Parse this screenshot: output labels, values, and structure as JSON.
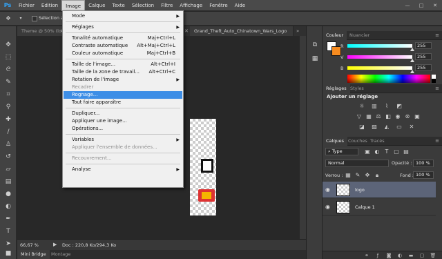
{
  "app": {
    "logo": "Ps"
  },
  "menubar": {
    "items": [
      "Fichier",
      "Edition",
      "Image",
      "Calque",
      "Texte",
      "Sélection",
      "Filtre",
      "Affichage",
      "Fenêtre",
      "Aide"
    ],
    "active": "Image"
  },
  "window_controls": {
    "minimize": "—",
    "maximize": "□",
    "close": "✕"
  },
  "options_bar": {
    "auto_select_label": "Sélection aut"
  },
  "documents": {
    "tabs": [
      {
        "title": "Theme @ 50% (log",
        "close": "✕"
      },
      {
        "title": "Grand_Theft_Auto_Chinatown_Wars_Logo",
        "close": "✕"
      }
    ],
    "overflow_indicator": "»"
  },
  "status_bar": {
    "zoom": "66,67 %",
    "doc_info": "Doc : 220,8 Ko/294,3 Ko",
    "arrow": "▶"
  },
  "bottom_tabs": [
    "Mini Bridge",
    "Montage"
  ],
  "image_menu": {
    "items": [
      {
        "label": "Mode",
        "shortcut": "",
        "submenu": true,
        "disabled": false
      },
      {
        "sep": true
      },
      {
        "label": "Réglages",
        "shortcut": "",
        "submenu": true,
        "disabled": false
      },
      {
        "sep": true
      },
      {
        "label": "Tonalité automatique",
        "shortcut": "Maj+Ctrl+L",
        "submenu": false,
        "disabled": false
      },
      {
        "label": "Contraste automatique",
        "shortcut": "Alt+Maj+Ctrl+L",
        "submenu": false,
        "disabled": false
      },
      {
        "label": "Couleur automatique",
        "shortcut": "Maj+Ctrl+B",
        "submenu": false,
        "disabled": false
      },
      {
        "sep": true
      },
      {
        "label": "Taille de l'image...",
        "shortcut": "Alt+Ctrl+I",
        "submenu": false,
        "disabled": false
      },
      {
        "label": "Taille de la zone de travail...",
        "shortcut": "Alt+Ctrl+C",
        "submenu": false,
        "disabled": false
      },
      {
        "label": "Rotation de l'image",
        "shortcut": "",
        "submenu": true,
        "disabled": false
      },
      {
        "label": "Recadrer",
        "shortcut": "",
        "submenu": false,
        "disabled": true
      },
      {
        "label": "Rognage...",
        "shortcut": "",
        "submenu": false,
        "disabled": false,
        "highlight": true
      },
      {
        "label": "Tout faire apparaître",
        "shortcut": "",
        "submenu": false,
        "disabled": false
      },
      {
        "sep": true
      },
      {
        "label": "Dupliquer...",
        "shortcut": "",
        "submenu": false,
        "disabled": false
      },
      {
        "label": "Appliquer une image...",
        "shortcut": "",
        "submenu": false,
        "disabled": false
      },
      {
        "label": "Opérations...",
        "shortcut": "",
        "submenu": false,
        "disabled": false
      },
      {
        "sep": true
      },
      {
        "label": "Variables",
        "shortcut": "",
        "submenu": true,
        "disabled": false
      },
      {
        "label": "Appliquer l'ensemble de données...",
        "shortcut": "",
        "submenu": false,
        "disabled": true
      },
      {
        "sep": true
      },
      {
        "label": "Recouvrement...",
        "shortcut": "",
        "submenu": false,
        "disabled": true
      },
      {
        "sep": true
      },
      {
        "label": "Analyse",
        "shortcut": "",
        "submenu": true,
        "disabled": false
      }
    ]
  },
  "color_panel": {
    "tabs": [
      "Couleur",
      "Nuancier"
    ],
    "channels": [
      {
        "label": "R",
        "value": "255",
        "level": 1.0
      },
      {
        "label": "V",
        "value": "255",
        "level": 1.0
      },
      {
        "label": "B",
        "value": "255",
        "level": 1.0
      }
    ],
    "foreground": "#ffffff",
    "background": "#f68b1f"
  },
  "adjustments_panel": {
    "tabs": [
      "Réglages",
      "Styles"
    ],
    "title": "Ajouter un réglage",
    "icon_rows": [
      [
        "brightness-icon",
        "levels-icon",
        "curves-icon",
        "exposure-icon"
      ],
      [
        "vibrance-icon",
        "hue-saturation-icon",
        "color-balance-icon",
        "black-white-icon",
        "photo-filter-icon",
        "channel-mixer-icon",
        "color-lookup-icon"
      ],
      [
        "invert-icon",
        "posterize-icon",
        "threshold-icon",
        "gradient-map-icon",
        "selective-color-icon"
      ]
    ]
  },
  "layers_panel": {
    "tabs": [
      "Calques",
      "Couches",
      "Tracés"
    ],
    "filter_label": "Type",
    "blend_mode": "Normal",
    "opacity_label": "Opacité :",
    "opacity_value": "100 %",
    "lock_label": "Verrou :",
    "fill_label": "Fond :",
    "fill_value": "100 %",
    "layers": [
      {
        "name": "logo",
        "selected": true
      },
      {
        "name": "Calque 1",
        "selected": false
      }
    ]
  }
}
